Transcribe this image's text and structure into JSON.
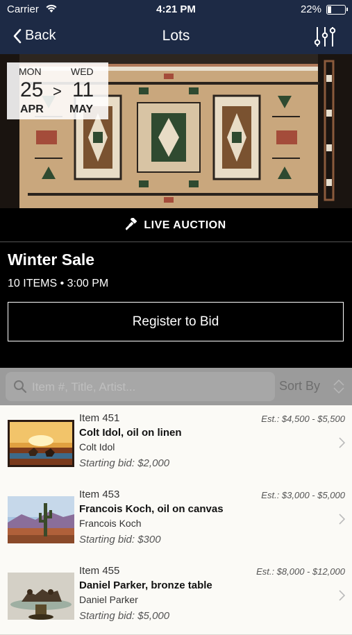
{
  "status_bar": {
    "carrier": "Carrier",
    "time": "4:21 PM",
    "battery": "22%",
    "battery_level": 0.22
  },
  "nav": {
    "back_label": "Back",
    "title": "Lots",
    "filter_icon": "sliders-icon"
  },
  "date_range": {
    "start": {
      "dow": "MON",
      "day": "25",
      "month": "APR"
    },
    "separator": ">",
    "end": {
      "dow": "WED",
      "day": "11",
      "month": "MAY"
    }
  },
  "live_banner": {
    "icon": "gavel-icon",
    "label": "LIVE AUCTION"
  },
  "sale": {
    "name": "Winter Sale",
    "meta": "10 ITEMS • 3:00 PM",
    "register_label": "Register to Bid"
  },
  "search": {
    "placeholder": "Item #, Title, Artist...",
    "sort_label": "Sort By",
    "value": ""
  },
  "lots": [
    {
      "item": "Item 451",
      "title": "Colt Idol, oil on linen",
      "artist": "Colt Idol",
      "starting_bid": "Starting bid: $2,000",
      "estimate": "Est.: $4,500 - $5,500"
    },
    {
      "item": "Item 453",
      "title": "Francois Koch, oil on canvas",
      "artist": "Francois Koch",
      "starting_bid": "Starting bid: $300",
      "estimate": "Est.: $3,000 - $5,000"
    },
    {
      "item": "Item 455",
      "title": "Daniel Parker, bronze table",
      "artist": "Daniel Parker",
      "starting_bid": "Starting bid: $5,000",
      "estimate": "Est.: $8,000 - $12,000"
    }
  ],
  "colors": {
    "nav_bg": "#1d2a45",
    "black_panel": "#000000",
    "list_bg": "#fbfaf6",
    "rug_tan": "#c9a77d",
    "rug_green": "#2f4a30"
  }
}
